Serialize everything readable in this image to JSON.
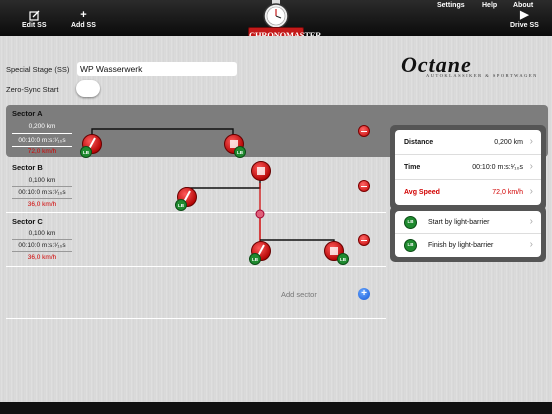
{
  "toolbar": {
    "edit_label": "Edit SS",
    "add_label": "Add SS",
    "drive_label": "Drive SS"
  },
  "logo": {
    "text": "CHRONOMASTER"
  },
  "stage": {
    "label": "Special Stage (SS)",
    "value": "WP Wasserwerk",
    "zero_sync_label": "Zero-Sync Start",
    "zero_sync_on": false
  },
  "brand": {
    "name": "Octane",
    "tagline": "AUTOKLASSIKER & SPORTWAGEN"
  },
  "sectors": [
    {
      "title": "Sector A",
      "distance": "0,200 km",
      "time": "00:10:0 m:s:¹⁄₁₀s",
      "speed": "72,0 km/h",
      "selected": true
    },
    {
      "title": "Sector B",
      "distance": "0,100 km",
      "time": "00:10:0 m:s:¹⁄₁₀s",
      "speed": "36,0 km/h",
      "selected": false
    },
    {
      "title": "Sector C",
      "distance": "0,100 km",
      "time": "00:10:0 m:s:¹⁄₁₀s",
      "speed": "36,0 km/h",
      "selected": false
    }
  ],
  "add_sector_label": "Add sector",
  "details": {
    "distance_label": "Distance",
    "distance_value": "0,200 km",
    "time_label": "Time",
    "time_value": "00:10:0 m:s:¹⁄₁₀s",
    "speed_label": "Avg Speed",
    "speed_value": "72,0 km/h"
  },
  "barriers": {
    "start_label": "Start by light-barrier",
    "finish_label": "Finish by light-barrier",
    "badge": "LB"
  },
  "bottom": {
    "settings": "Settings",
    "help": "Help",
    "about": "About"
  },
  "colors": {
    "accent_red": "#d20000",
    "lb_green": "#1f8a2f",
    "add_blue": "#1458d6"
  }
}
